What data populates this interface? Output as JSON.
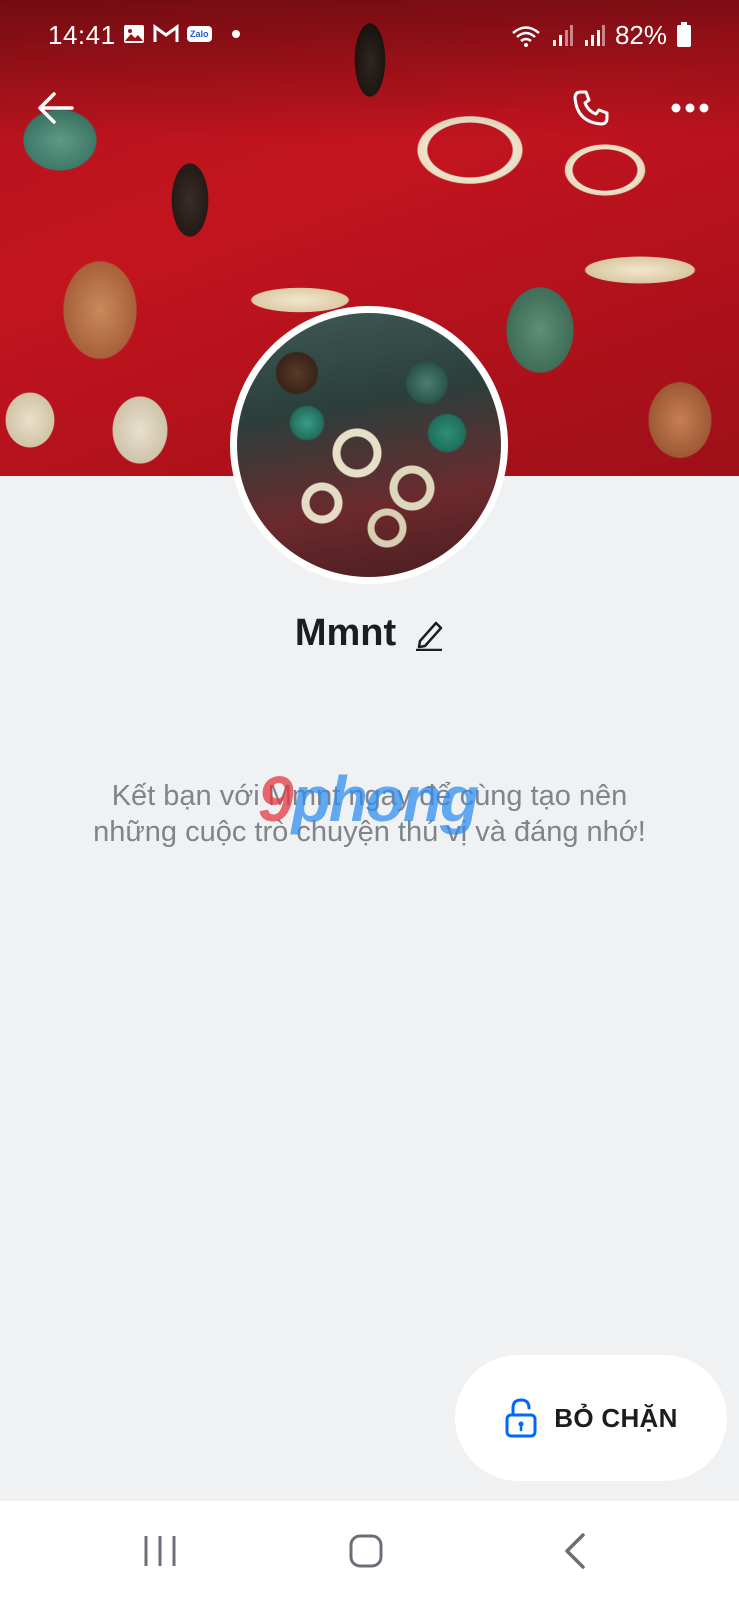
{
  "status_bar": {
    "time": "14:41",
    "zalo_badge": "Zalo",
    "battery": "82%"
  },
  "header": {
    "back_icon": "arrow-left-icon",
    "call_icon": "phone-icon",
    "more_icon": "more-horizontal-icon"
  },
  "profile": {
    "name": "Mmnt",
    "edit_icon": "pencil-icon",
    "hint": "Kết bạn với Mmnt ngay để cùng tạo nên những cuộc trò chuyện thú vị và đáng nhớ!"
  },
  "watermark": {
    "part1": "9",
    "part2": "phong"
  },
  "action": {
    "unblock_label": "BỎ CHẶN",
    "unblock_icon": "unlock-icon"
  },
  "colors": {
    "accent": "#0068ff",
    "text": "#1b1d21",
    "muted": "#7e858c",
    "background": "#eff1f3"
  }
}
